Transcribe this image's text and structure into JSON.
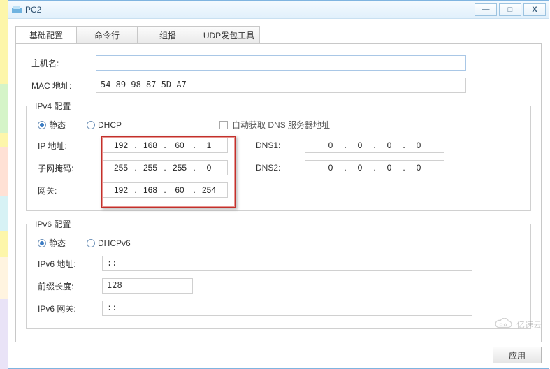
{
  "window": {
    "title": "PC2"
  },
  "win_buttons": {
    "min": "—",
    "max": "□",
    "close": "X"
  },
  "tabs": [
    {
      "label": "基础配置",
      "active": true
    },
    {
      "label": "命令行",
      "active": false
    },
    {
      "label": "组播",
      "active": false
    },
    {
      "label": "UDP发包工具",
      "active": false
    }
  ],
  "basic": {
    "hostname_label": "主机名:",
    "hostname_value": "",
    "mac_label": "MAC 地址:",
    "mac_value": "54-89-98-87-5D-A7"
  },
  "ipv4": {
    "legend": "IPv4 配置",
    "radio_static": "静态",
    "radio_dhcp": "DHCP",
    "auto_dns_label": "自动获取 DNS 服务器地址",
    "ip_label": "IP 地址:",
    "mask_label": "子网掩码:",
    "gw_label": "网关:",
    "dns1_label": "DNS1:",
    "dns2_label": "DNS2:",
    "ip": {
      "a": "192",
      "b": "168",
      "c": "60",
      "d": "1"
    },
    "mask": {
      "a": "255",
      "b": "255",
      "c": "255",
      "d": "0"
    },
    "gw": {
      "a": "192",
      "b": "168",
      "c": "60",
      "d": "254"
    },
    "dns1": {
      "a": "0",
      "b": "0",
      "c": "0",
      "d": "0"
    },
    "dns2": {
      "a": "0",
      "b": "0",
      "c": "0",
      "d": "0"
    }
  },
  "ipv6": {
    "legend": "IPv6 配置",
    "radio_static": "静态",
    "radio_dhcp": "DHCPv6",
    "addr_label": "IPv6 地址:",
    "addr_value": "::",
    "prefix_label": "前缀长度:",
    "prefix_value": "128",
    "gw_label": "IPv6 网关:",
    "gw_value": "::"
  },
  "buttons": {
    "apply": "应用"
  },
  "watermark": "亿速云",
  "dots": {
    "d": "."
  }
}
